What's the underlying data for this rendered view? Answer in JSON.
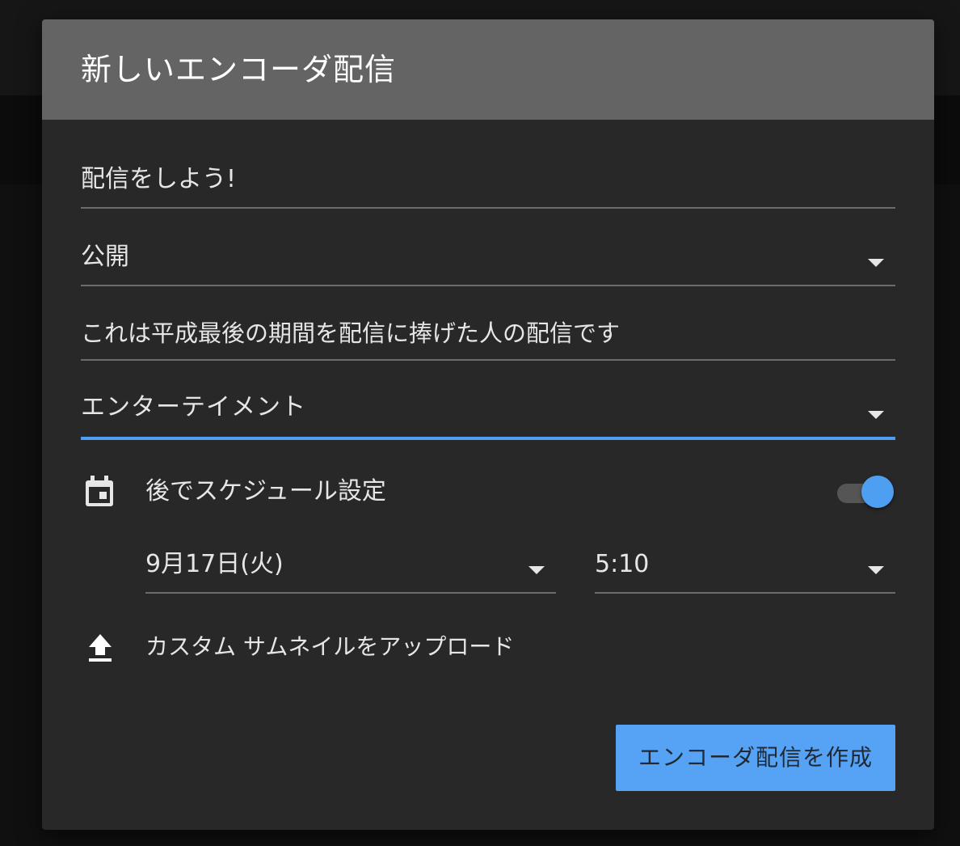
{
  "dialog": {
    "title": "新しいエンコーダ配信"
  },
  "form": {
    "title_value": "配信をしよう!",
    "privacy_value": "公開",
    "description_value": "これは平成最後の期間を配信に捧げた人の配信です",
    "category_value": "エンターテイメント",
    "schedule_label": "後でスケジュール設定",
    "schedule_enabled": true,
    "date_value": "9月17日(火)",
    "time_value": "5:10",
    "upload_label": "カスタム サムネイルをアップロード"
  },
  "actions": {
    "create_label": "エンコーダ配信を作成"
  },
  "icons": {
    "schedule": "calendar-icon",
    "upload": "upload-icon",
    "dropdown": "chevron-down-icon"
  },
  "colors": {
    "accent": "#4e9ff2",
    "button": "#56a3f5",
    "header": "#646464",
    "dialog": "#282828"
  }
}
